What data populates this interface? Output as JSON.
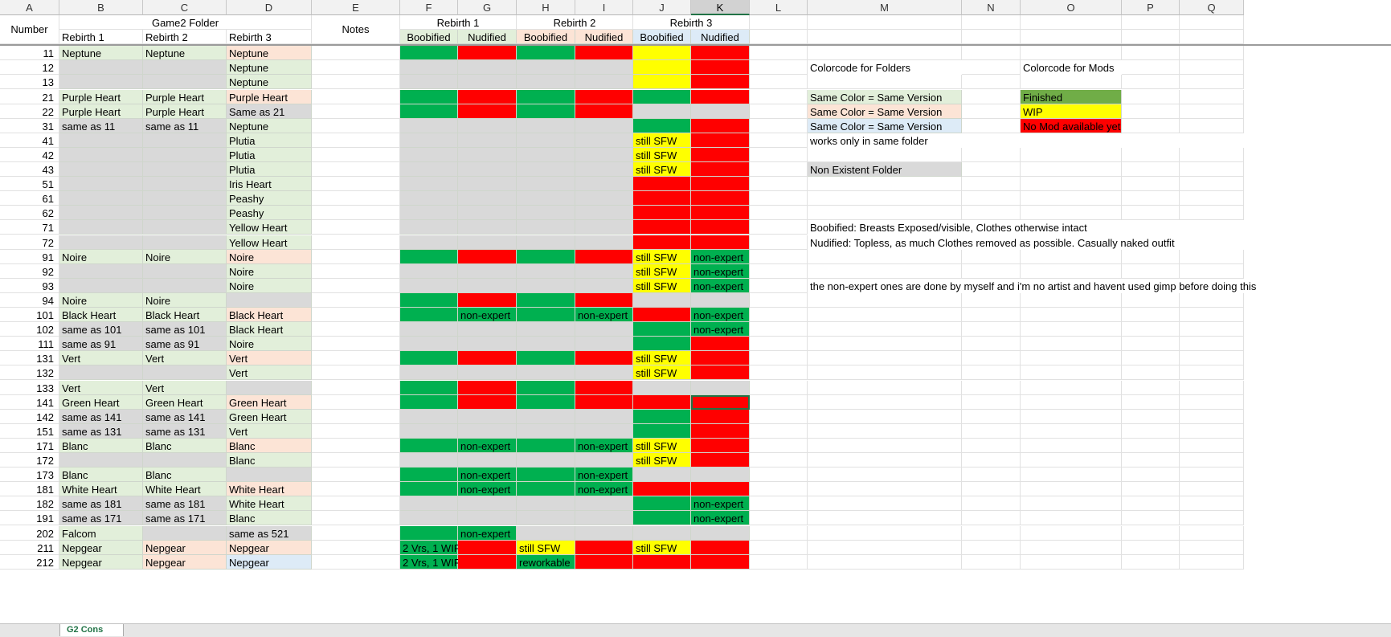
{
  "colors": {
    "green": "#00b050",
    "red": "#ff0000",
    "yellow": "#ffff00",
    "gray": "#d9d9d9",
    "lightgreen": "#e2efda",
    "peach": "#fce4d6",
    "lightblue": "#ddebf7",
    "darkgreen": "#70ad47"
  },
  "column_letters": [
    "A",
    "B",
    "C",
    "D",
    "E",
    "F",
    "G",
    "H",
    "I",
    "J",
    "K",
    "L",
    "M",
    "N",
    "O",
    "P",
    "Q"
  ],
  "header": {
    "number": "Number",
    "game2_folder": "Game2 Folder",
    "notes": "Notes",
    "rebirth1": "Rebirth 1",
    "rebirth2": "Rebirth 2",
    "rebirth3": "Rebirth 3",
    "boobified": "Boobified",
    "nudified": "Nudified"
  },
  "legend": {
    "folders_title": "Colorcode for Folders",
    "mods_title": "Colorcode for Mods",
    "same_version": "Same Color = Same Version",
    "finished": "Finished",
    "wip": "WIP",
    "no_mod": "No Mod available yet",
    "same_folder": "works only in same folder",
    "non_existent": "Non Existent Folder",
    "boobified_desc": "Boobified: Breasts Exposed/visible, Clothes otherwise intact",
    "nudified_desc": "Nudified: Topless, as much Clothes removed as possible. Casually naked outfit",
    "non_expert_note": "the non-expert ones are done by myself and i'm no artist and havent used gimp before doing this"
  },
  "rows": [
    {
      "n": "11",
      "b": "Neptune",
      "bc": "L",
      "c": "Neptune",
      "cc": "L",
      "d": "Neptune",
      "dc": "P",
      "f": "G",
      "g": "R",
      "h": "G",
      "i": "R",
      "j": "Y",
      "k": "R"
    },
    {
      "n": "12",
      "b": "",
      "bc": "X",
      "c": "",
      "cc": "X",
      "d": "Neptune",
      "dc": "L",
      "f": "X",
      "g": "X",
      "h": "X",
      "i": "X",
      "j": "Y",
      "k": "R"
    },
    {
      "n": "13",
      "b": "",
      "bc": "X",
      "c": "",
      "cc": "X",
      "d": "Neptune",
      "dc": "L",
      "f": "X",
      "g": "X",
      "h": "X",
      "i": "X",
      "j": "Y",
      "k": "R"
    },
    {
      "n": "21",
      "b": "Purple Heart",
      "bc": "L",
      "c": "Purple Heart",
      "cc": "L",
      "d": "Purple Heart",
      "dc": "P",
      "f": "G",
      "g": "R",
      "h": "G",
      "i": "R",
      "j": "G",
      "k": "R"
    },
    {
      "n": "22",
      "b": "Purple Heart",
      "bc": "L",
      "c": "Purple Heart",
      "cc": "L",
      "d": "Same as 21",
      "dc": "X",
      "f": "G",
      "g": "R",
      "h": "G",
      "i": "R",
      "j": "X",
      "k": "X"
    },
    {
      "n": "31",
      "b": "same as 11",
      "bc": "X",
      "c": "same as 11",
      "cc": "X",
      "d": "Neptune",
      "dc": "L",
      "f": "X",
      "g": "X",
      "h": "X",
      "i": "X",
      "j": "G",
      "k": "R"
    },
    {
      "n": "41",
      "b": "",
      "bc": "X",
      "c": "",
      "cc": "X",
      "d": "Plutia",
      "dc": "L",
      "f": "X",
      "g": "X",
      "h": "X",
      "i": "X",
      "j": "Y",
      "jt": "still SFW",
      "k": "R"
    },
    {
      "n": "42",
      "b": "",
      "bc": "X",
      "c": "",
      "cc": "X",
      "d": "Plutia",
      "dc": "L",
      "f": "X",
      "g": "X",
      "h": "X",
      "i": "X",
      "j": "Y",
      "jt": "still SFW",
      "k": "R"
    },
    {
      "n": "43",
      "b": "",
      "bc": "X",
      "c": "",
      "cc": "X",
      "d": "Plutia",
      "dc": "L",
      "f": "X",
      "g": "X",
      "h": "X",
      "i": "X",
      "j": "Y",
      "jt": "still SFW",
      "k": "R"
    },
    {
      "n": "51",
      "b": "",
      "bc": "X",
      "c": "",
      "cc": "X",
      "d": "Iris Heart",
      "dc": "L",
      "f": "X",
      "g": "X",
      "h": "X",
      "i": "X",
      "j": "R",
      "k": "R"
    },
    {
      "n": "61",
      "b": "",
      "bc": "X",
      "c": "",
      "cc": "X",
      "d": "Peashy",
      "dc": "L",
      "f": "X",
      "g": "X",
      "h": "X",
      "i": "X",
      "j": "R",
      "k": "R"
    },
    {
      "n": "62",
      "b": "",
      "bc": "X",
      "c": "",
      "cc": "X",
      "d": "Peashy",
      "dc": "L",
      "f": "X",
      "g": "X",
      "h": "X",
      "i": "X",
      "j": "R",
      "k": "R"
    },
    {
      "n": "71",
      "b": "",
      "bc": "X",
      "c": "",
      "cc": "X",
      "d": "Yellow Heart",
      "dc": "L",
      "f": "X",
      "g": "X",
      "h": "X",
      "i": "X",
      "j": "R",
      "k": "R"
    },
    {
      "n": "72",
      "b": "",
      "bc": "X",
      "c": "",
      "cc": "X",
      "d": "Yellow Heart",
      "dc": "L",
      "f": "X",
      "g": "X",
      "h": "X",
      "i": "X",
      "j": "R",
      "k": "R"
    },
    {
      "n": "91",
      "b": "Noire",
      "bc": "L",
      "c": "Noire",
      "cc": "L",
      "d": "Noire",
      "dc": "P",
      "f": "G",
      "g": "R",
      "h": "G",
      "i": "R",
      "j": "Y",
      "jt": "still SFW",
      "k": "G",
      "kt": "non-expert"
    },
    {
      "n": "92",
      "b": "",
      "bc": "X",
      "c": "",
      "cc": "X",
      "d": "Noire",
      "dc": "L",
      "f": "X",
      "g": "X",
      "h": "X",
      "i": "X",
      "j": "Y",
      "jt": "still SFW",
      "k": "G",
      "kt": "non-expert"
    },
    {
      "n": "93",
      "b": "",
      "bc": "X",
      "c": "",
      "cc": "X",
      "d": "Noire",
      "dc": "L",
      "f": "X",
      "g": "X",
      "h": "X",
      "i": "X",
      "j": "Y",
      "jt": "still SFW",
      "k": "G",
      "kt": "non-expert"
    },
    {
      "n": "94",
      "b": "Noire",
      "bc": "L",
      "c": "Noire",
      "cc": "L",
      "d": "",
      "dc": "X",
      "f": "G",
      "g": "R",
      "h": "G",
      "i": "R",
      "j": "X",
      "k": "X"
    },
    {
      "n": "101",
      "b": "Black Heart",
      "bc": "L",
      "c": "Black Heart",
      "cc": "L",
      "d": "Black Heart",
      "dc": "P",
      "f": "G",
      "g": "G",
      "gt": "non-expert",
      "h": "G",
      "i": "G",
      "it": "non-expert",
      "j": "R",
      "k": "G",
      "kt": "non-expert"
    },
    {
      "n": "102",
      "b": "same as 101",
      "bc": "X",
      "c": "same as 101",
      "cc": "X",
      "d": "Black Heart",
      "dc": "L",
      "f": "X",
      "g": "X",
      "h": "X",
      "i": "X",
      "j": "G",
      "k": "G",
      "kt": "non-expert"
    },
    {
      "n": "111",
      "b": "same as 91",
      "bc": "X",
      "c": "same as 91",
      "cc": "X",
      "d": "Noire",
      "dc": "L",
      "f": "X",
      "g": "X",
      "h": "X",
      "i": "X",
      "j": "G",
      "k": "R"
    },
    {
      "n": "131",
      "b": "Vert",
      "bc": "L",
      "c": "Vert",
      "cc": "L",
      "d": "Vert",
      "dc": "P",
      "f": "G",
      "g": "R",
      "h": "G",
      "i": "R",
      "j": "Y",
      "jt": "still SFW",
      "k": "R"
    },
    {
      "n": "132",
      "b": "",
      "bc": "X",
      "c": "",
      "cc": "X",
      "d": "Vert",
      "dc": "L",
      "f": "X",
      "g": "X",
      "h": "X",
      "i": "X",
      "j": "Y",
      "jt": "still SFW",
      "k": "R"
    },
    {
      "n": "133",
      "b": "Vert",
      "bc": "L",
      "c": "Vert",
      "cc": "L",
      "d": "",
      "dc": "X",
      "f": "G",
      "g": "R",
      "h": "G",
      "i": "R",
      "j": "X",
      "k": "X"
    },
    {
      "n": "141",
      "b": "Green Heart",
      "bc": "L",
      "c": "Green Heart",
      "cc": "L",
      "d": "Green Heart",
      "dc": "P",
      "f": "G",
      "g": "R",
      "h": "G",
      "i": "R",
      "j": "R",
      "k": "R"
    },
    {
      "n": "142",
      "b": "same as 141",
      "bc": "X",
      "c": "same as 141",
      "cc": "X",
      "d": "Green Heart",
      "dc": "L",
      "f": "X",
      "g": "X",
      "h": "X",
      "i": "X",
      "j": "G",
      "k": "R"
    },
    {
      "n": "151",
      "b": "same as 131",
      "bc": "X",
      "c": "same as 131",
      "cc": "X",
      "d": "Vert",
      "dc": "L",
      "f": "X",
      "g": "X",
      "h": "X",
      "i": "X",
      "j": "G",
      "k": "R"
    },
    {
      "n": "171",
      "b": "Blanc",
      "bc": "L",
      "c": "Blanc",
      "cc": "L",
      "d": "Blanc",
      "dc": "P",
      "f": "G",
      "g": "G",
      "gt": "non-expert",
      "h": "G",
      "i": "G",
      "it": "non-expert",
      "j": "Y",
      "jt": "still SFW",
      "k": "R"
    },
    {
      "n": "172",
      "b": "",
      "bc": "X",
      "c": "",
      "cc": "X",
      "d": "Blanc",
      "dc": "L",
      "f": "X",
      "g": "X",
      "h": "X",
      "i": "X",
      "j": "Y",
      "jt": "still SFW",
      "k": "R"
    },
    {
      "n": "173",
      "b": "Blanc",
      "bc": "L",
      "c": "Blanc",
      "cc": "L",
      "d": "",
      "dc": "X",
      "f": "G",
      "g": "G",
      "gt": "non-expert",
      "h": "G",
      "i": "G",
      "it": "non-expert",
      "j": "X",
      "k": "X"
    },
    {
      "n": "181",
      "b": "White Heart",
      "bc": "L",
      "c": "White Heart",
      "cc": "L",
      "d": "White Heart",
      "dc": "P",
      "f": "G",
      "g": "G",
      "gt": "non-expert",
      "h": "G",
      "i": "G",
      "it": "non-expert",
      "j": "R",
      "k": "R"
    },
    {
      "n": "182",
      "b": "same as 181",
      "bc": "X",
      "c": "same as 181",
      "cc": "X",
      "d": "White Heart",
      "dc": "L",
      "f": "X",
      "g": "X",
      "h": "X",
      "i": "X",
      "j": "G",
      "k": "G",
      "kt": "non-expert"
    },
    {
      "n": "191",
      "b": "same as 171",
      "bc": "X",
      "c": "same as 171",
      "cc": "X",
      "d": "Blanc",
      "dc": "L",
      "f": "X",
      "g": "X",
      "h": "X",
      "i": "X",
      "j": "G",
      "k": "G",
      "kt": "non-expert"
    },
    {
      "n": "202",
      "b": "Falcom",
      "bc": "L",
      "c": "",
      "cc": "X",
      "d": "same as 521",
      "dc": "X",
      "f": "G",
      "g": "G",
      "gt": "non-expert",
      "h": "X",
      "i": "X",
      "j": "X",
      "k": "X"
    },
    {
      "n": "211",
      "b": "Nepgear",
      "bc": "L",
      "c": "Nepgear",
      "cc": "P",
      "d": "Nepgear",
      "dc": "P",
      "f": "G",
      "ft": "2 Vrs, 1 WIP",
      "g": "R",
      "h": "Y",
      "ht": "still SFW",
      "i": "R",
      "j": "Y",
      "jt": "still SFW",
      "k": "R"
    },
    {
      "n": "212",
      "b": "Nepgear",
      "bc": "L",
      "c": "Nepgear",
      "cc": "P",
      "d": "Nepgear",
      "dc": "B",
      "f": "G",
      "ft": "2 Vrs, 1 WIP",
      "g": "R",
      "h": "G",
      "ht": "reworkable",
      "i": "R",
      "j": "R",
      "k": "R"
    }
  ],
  "sheet_tabs": [
    "G2 Cons",
    "",
    ""
  ]
}
